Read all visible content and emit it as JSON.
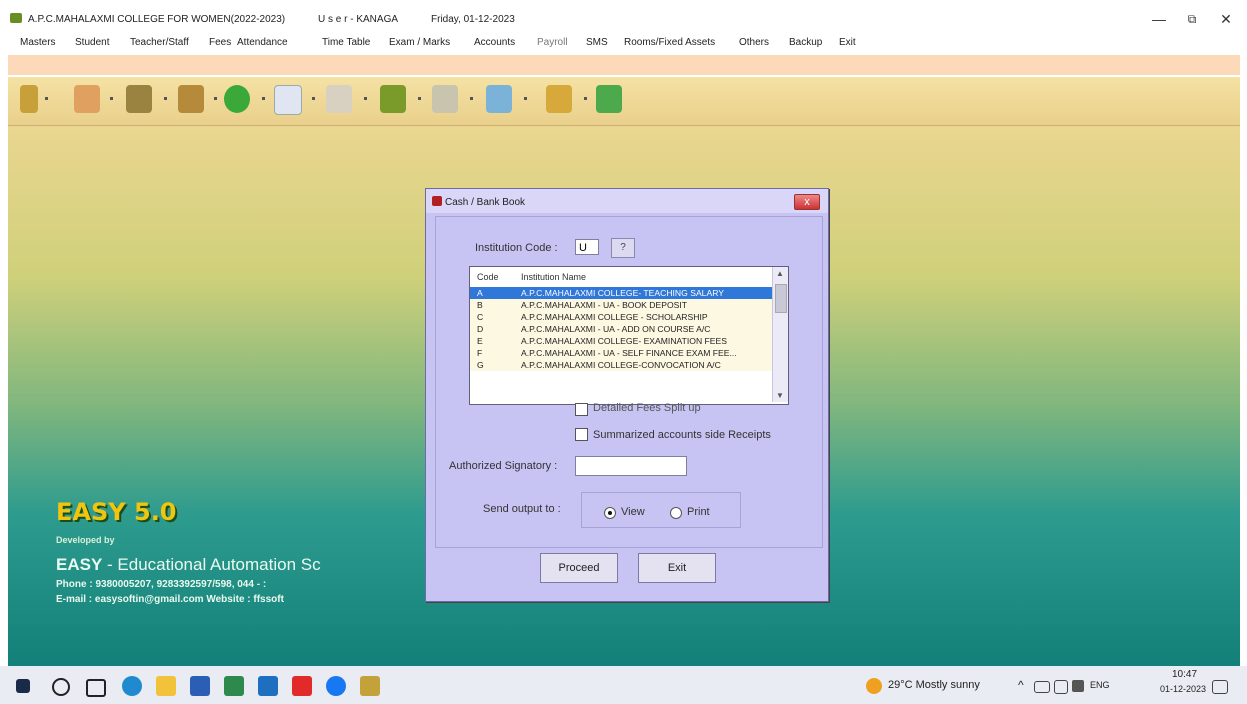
{
  "titlebar": {
    "app_title": "A.P.C.MAHALAXMI COLLEGE FOR WOMEN(2022-2023)",
    "user": "U s e r - KANAGA",
    "date": "Friday, 01-12-2023",
    "minimize": "—",
    "restore": "⧉",
    "close": "✕"
  },
  "menu": [
    "Masters",
    "Student",
    "Teacher/Staff",
    "Fees",
    "Attendance",
    "Time Table",
    "Exam / Marks",
    "Accounts",
    "Payroll",
    "SMS",
    "Rooms/Fixed Assets",
    "Others",
    "Backup",
    "Exit"
  ],
  "brand": {
    "title": "EASY 5.0",
    "developed_by": "Developed by",
    "name_bold": "EASY",
    "name_rest": " - Educational Automation Sc",
    "phone": "Phone : 9380005207, 9283392597/598, 044 - :",
    "email": "E-mail : easysoftin@gmail.com     Website : ffssoft"
  },
  "dialog": {
    "title": "Cash / Bank Book",
    "close": "x",
    "institution_code_label": "Institution Code :",
    "institution_code_value": "U",
    "lookup_button": "?",
    "list_headers": {
      "code": "Code",
      "name": "Institution Name"
    },
    "list_rows": [
      {
        "code": "A",
        "name": "A.P.C.MAHALAXMI COLLEGE- TEACHING SALARY"
      },
      {
        "code": "B",
        "name": "A.P.C.MAHALAXMI - UA - BOOK DEPOSIT"
      },
      {
        "code": "C",
        "name": "A.P.C.MAHALAXMI COLLEGE - SCHOLARSHIP"
      },
      {
        "code": "D",
        "name": "A.P.C.MAHALAXMI - UA - ADD ON COURSE A/C"
      },
      {
        "code": "E",
        "name": "A.P.C.MAHALAXMI COLLEGE- EXAMINATION FEES"
      },
      {
        "code": "F",
        "name": "A.P.C.MAHALAXMI - UA - SELF FINANCE EXAM FEE..."
      },
      {
        "code": "G",
        "name": "A.P.C.MAHALAXMI COLLEGE-CONVOCATION A/C"
      }
    ],
    "detailed_fees": "Detailed Fees Split up",
    "summarized": "Summarized accounts side Receipts",
    "signatory_label": "Authorized Signatory :",
    "signatory_value": "",
    "send_output_label": "Send output to :",
    "view": "View",
    "print": "Print",
    "proceed": "Proceed",
    "exit": "Exit"
  },
  "taskbar": {
    "weather": "29°C  Mostly sunny",
    "lang": "ENG",
    "time": "10:47",
    "date": "01-12-2023"
  }
}
